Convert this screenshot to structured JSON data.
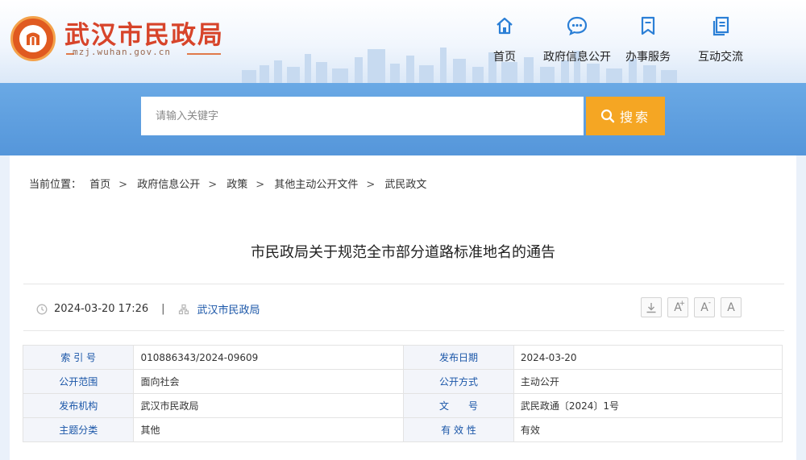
{
  "site": {
    "title": "武汉市民政局",
    "domain": "mzj.wuhan.gov.cn"
  },
  "nav": [
    {
      "label": "首页",
      "icon": "home-icon"
    },
    {
      "label": "政府信息公开",
      "icon": "chat-bubble-icon"
    },
    {
      "label": "办事服务",
      "icon": "bookmark-icon"
    },
    {
      "label": "互动交流",
      "icon": "documents-icon"
    }
  ],
  "search": {
    "placeholder": "请输入关键字",
    "button_label": "搜索"
  },
  "breadcrumb": {
    "prefix": "当前位置：",
    "items": [
      "首页",
      "政府信息公开",
      "政策",
      "其他主动公开文件",
      "武民政文"
    ]
  },
  "article": {
    "title": "市民政局关于规范全市部分道路标准地名的通告",
    "datetime": "2024-03-20 17:26",
    "source": "武汉市民政局"
  },
  "tools": {
    "increase": "A",
    "reset": "A",
    "decrease": "A"
  },
  "info_table": {
    "rows": [
      {
        "k1": "索 引 号",
        "v1": "010886343/2024-09609",
        "k2": "发布日期",
        "v2": "2024-03-20"
      },
      {
        "k1": "公开范围",
        "v1": "面向社会",
        "k2": "公开方式",
        "v2": "主动公开"
      },
      {
        "k1": "发布机构",
        "v1": "武汉市民政局",
        "k2": "文　　号",
        "v2": "武民政通〔2024〕1号"
      },
      {
        "k1": "主题分类",
        "v1": "其他",
        "k2": "有 效 性",
        "v2": "有效"
      }
    ]
  },
  "colors": {
    "brand_red": "#d7442a",
    "search_band": "#5c9ddf",
    "search_button": "#f5a623",
    "link_blue": "#1a56a8",
    "nav_icon": "#2b7fd6"
  }
}
